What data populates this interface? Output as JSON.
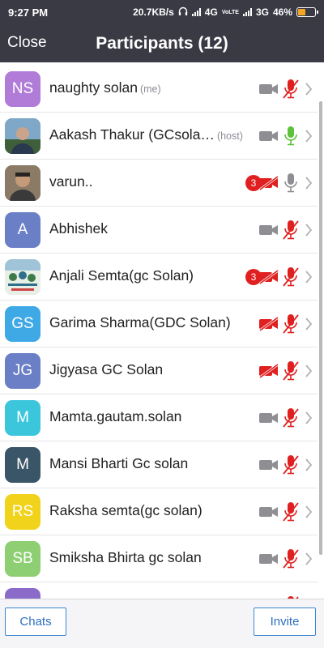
{
  "status_bar": {
    "time": "9:27 PM",
    "network_speed": "20.7KB/s",
    "net1": "4G",
    "volte": "VoLTE",
    "net2": "3G",
    "battery": "46%",
    "battery_level": 0.46
  },
  "header": {
    "close_label": "Close",
    "title": "Participants (12)"
  },
  "participants": [
    {
      "initials": "NS",
      "name": "naughty solan",
      "tag": "(me)",
      "avatar_color": "#b07cd8",
      "photo": false,
      "badge": "",
      "video": "on",
      "audio": "muted"
    },
    {
      "initials": "",
      "name": "Aakash Thakur (GCsola…",
      "tag": "(host)",
      "avatar_color": "#4a6b8a",
      "photo": true,
      "badge": "",
      "video": "on",
      "audio": "active"
    },
    {
      "initials": "",
      "name": "varun..",
      "tag": "",
      "avatar_color": "#6b5a4a",
      "photo": true,
      "badge": "3",
      "video": "off",
      "audio": "on"
    },
    {
      "initials": "A",
      "name": "Abhishek",
      "tag": "",
      "avatar_color": "#6a7fc6",
      "photo": false,
      "badge": "",
      "video": "on",
      "audio": "muted"
    },
    {
      "initials": "",
      "name": "Anjali Semta(gc Solan)",
      "tag": "",
      "avatar_color": "#8fbfa0",
      "photo": true,
      "badge": "3",
      "video": "off",
      "audio": "muted"
    },
    {
      "initials": "GS",
      "name": "Garima Sharma(GDC Solan)",
      "tag": "",
      "avatar_color": "#3fa9e6",
      "photo": false,
      "badge": "",
      "video": "off",
      "audio": "muted"
    },
    {
      "initials": "JG",
      "name": "Jigyasa GC Solan",
      "tag": "",
      "avatar_color": "#6a7fc6",
      "photo": false,
      "badge": "",
      "video": "off",
      "audio": "muted"
    },
    {
      "initials": "M",
      "name": "Mamta.gautam.solan",
      "tag": "",
      "avatar_color": "#3cc6dc",
      "photo": false,
      "badge": "",
      "video": "on",
      "audio": "muted"
    },
    {
      "initials": "M",
      "name": "Mansi Bharti Gc  solan",
      "tag": "",
      "avatar_color": "#3b5568",
      "photo": false,
      "badge": "",
      "video": "on",
      "audio": "muted"
    },
    {
      "initials": "RS",
      "name": "Raksha semta(gc solan)",
      "tag": "",
      "avatar_color": "#f2d31b",
      "photo": false,
      "badge": "",
      "video": "on",
      "audio": "muted"
    },
    {
      "initials": "SB",
      "name": "Smiksha Bhirta gc solan",
      "tag": "",
      "avatar_color": "#8fcf74",
      "photo": false,
      "badge": "",
      "video": "on",
      "audio": "muted"
    },
    {
      "initials": "",
      "name": "",
      "tag": "",
      "avatar_color": "#8a6bc9",
      "photo": false,
      "badge": "",
      "video": "on",
      "audio": "muted"
    }
  ],
  "footer": {
    "chats_label": "Chats",
    "invite_label": "Invite"
  },
  "colors": {
    "header_bg": "#3a3a45",
    "muted_red": "#e02020",
    "active_green": "#5cc23a",
    "icon_gray": "#8e8e93",
    "button_blue": "#2e6fc0"
  }
}
